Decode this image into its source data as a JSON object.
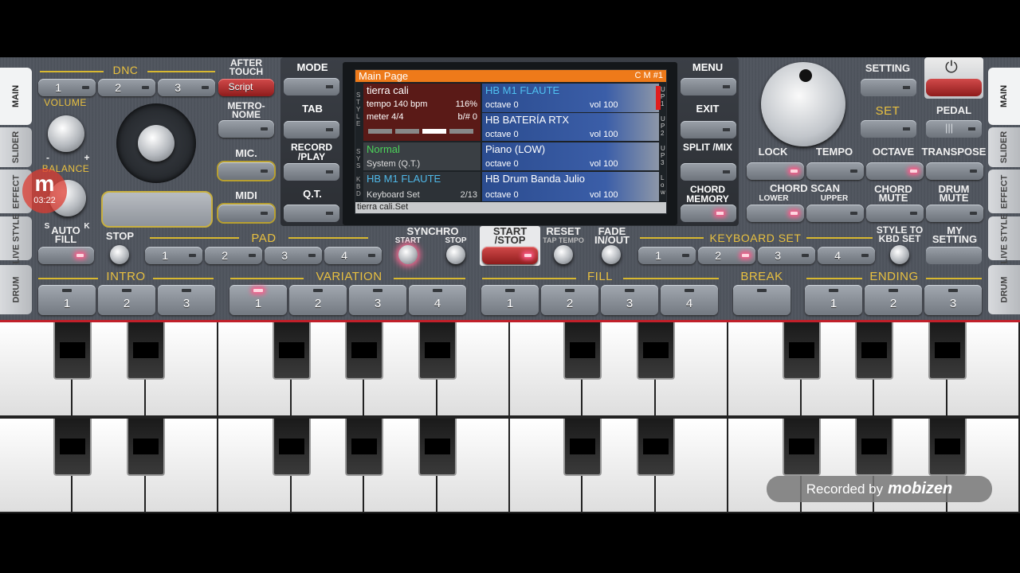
{
  "tabs_left": [
    "MAIN",
    "SLIDER",
    "EFFECT",
    "LIVE STYLE",
    "DRUM"
  ],
  "tabs_right": [
    "MAIN",
    "SLIDER",
    "EFFECT",
    "LIVE STYLE",
    "DRUM"
  ],
  "dnc": {
    "label": "DNC",
    "buttons": [
      "1",
      "2",
      "3"
    ],
    "after_touch": "AFTER TOUCH",
    "script": "Script"
  },
  "volume": "VOLUME",
  "balance": "BALANCE",
  "balance_s": "S",
  "balance_k": "K",
  "vol_minus": "-",
  "vol_plus": "+",
  "metronome": "METRO- NOME",
  "mic": "MIC.",
  "midi": "MIDI",
  "center": {
    "mode": "MODE",
    "tab": "TAB",
    "record": "RECORD /PLAY",
    "qt": "Q.T.",
    "menu": "MENU",
    "exit": "EXIT",
    "split": "SPLIT /MIX",
    "chord_memory": "CHORD MEMORY"
  },
  "display": {
    "title": "Main Page",
    "code": "C M #1",
    "style_name": "tierra cali",
    "tempo": "tempo 140 bpm",
    "percent": "116%",
    "meter": "meter 4/4",
    "bsharp": "b/# 0",
    "sys_name": "Normal",
    "sys_sub": "System (Q.T.)",
    "kbd_name": "HB M1 FLAUTE",
    "kbd_sub": "Keyboard Set",
    "kbd_count": "2/13",
    "side_style": "S T Y L E",
    "side_sys": "S Y S",
    "side_kbd": "K B D",
    "tracks": [
      {
        "name": "HB M1 FLAUTE",
        "octave": "octave  0",
        "vol": "vol 100",
        "tag": "U P 1"
      },
      {
        "name": "HB BATERÍA RTX",
        "octave": "octave  0",
        "vol": "vol 100",
        "tag": "U P 2"
      },
      {
        "name": "Piano (LOW)",
        "octave": "octave  0",
        "vol": "vol 100",
        "tag": "U P 3"
      },
      {
        "name": "HB Drum Banda Julio",
        "octave": "octave  0",
        "vol": "vol 100",
        "tag": "L o w"
      }
    ],
    "footer": "tierra cali.Set"
  },
  "right": {
    "setting": "SETTING",
    "set": "SET",
    "pedal": "PEDAL",
    "lock": "LOCK",
    "tempo": "TEMPO",
    "octave": "OCTAVE",
    "transpose": "TRANSPOSE",
    "chord_scan": "CHORD SCAN",
    "lower": "LOWER",
    "upper": "UPPER",
    "chord_mute": "CHORD MUTE",
    "drum_mute": "DRUM MUTE"
  },
  "row2": {
    "auto_fill": "AUTO FILL",
    "stop": "STOP",
    "pad": "PAD",
    "pad_buttons": [
      "1",
      "2",
      "3",
      "4"
    ],
    "synchro": "SYNCHRO",
    "sync_start": "START",
    "sync_stop": "STOP",
    "start_stop": "START /STOP",
    "reset": "RESET",
    "tap_tempo": "TAP TEMPO",
    "fade": "FADE IN/OUT",
    "keyboard_set": "KEYBOARD SET",
    "kbd_buttons": [
      "1",
      "2",
      "3",
      "4"
    ],
    "style_to_kbd": "STYLE TO KBD SET",
    "my_setting": "MY SETTING"
  },
  "row3": {
    "intro": "INTRO",
    "intro_buttons": [
      "1",
      "2",
      "3"
    ],
    "variation": "VARIATION",
    "variation_buttons": [
      "1",
      "2",
      "3",
      "4"
    ],
    "fill": "FILL",
    "fill_buttons": [
      "1",
      "2",
      "3",
      "4"
    ],
    "break": "BREAK",
    "ending": "ENDING",
    "ending_buttons": [
      "1",
      "2",
      "3"
    ]
  },
  "recorder": {
    "time": "03:22",
    "logo": "m"
  },
  "watermark": {
    "text": "Recorded by",
    "brand": "mobizen"
  }
}
